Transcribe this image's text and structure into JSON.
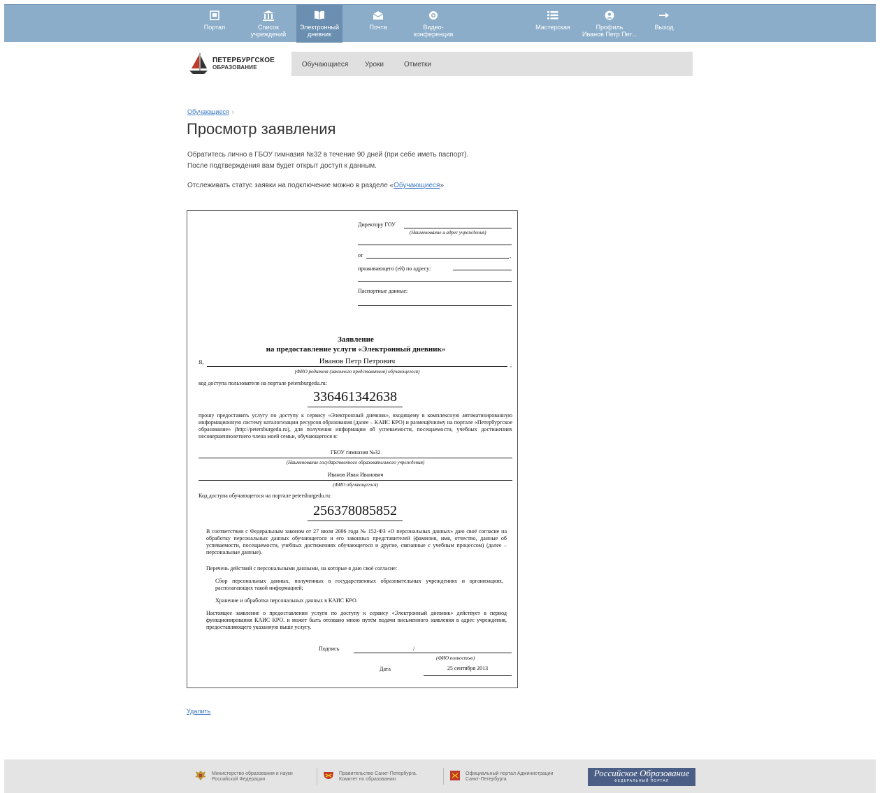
{
  "nav": {
    "items": [
      {
        "label": "Портал",
        "icon": "portal-icon"
      },
      {
        "label": "Список учреждений",
        "icon": "institution-icon"
      },
      {
        "label": "Электронный\nдневник",
        "icon": "book-icon",
        "active": true
      },
      {
        "label": "Почта",
        "icon": "mail-icon"
      },
      {
        "label": "Видео-\nконференции",
        "icon": "video-icon"
      },
      {
        "label": "Мастерская",
        "icon": "list-icon"
      },
      {
        "label": "Профиль\nИванов Петр Пет...",
        "icon": "profile-icon"
      },
      {
        "label": "Выход",
        "icon": "exit-icon"
      }
    ]
  },
  "logo": {
    "line1": "ПЕТЕРБУРГСКОЕ",
    "line2": "ОБРАЗОВАНИЕ"
  },
  "tabs": [
    "Обучающиеся",
    "Уроки",
    "Отметки"
  ],
  "breadcrumb": {
    "link": "Обучающиеся",
    "sep": "›"
  },
  "page_title": "Просмотр заявления",
  "info": {
    "line1": "Обратитесь лично в ГБОУ гимназия №32 в течение 90 дней (при себе иметь паспорт).",
    "line2": "После подтверждения вам будет открыт доступ к данным.",
    "status_prefix": "Отслеживать статус заявки на подключение можно в разделе «",
    "status_link": "Обучающиеся",
    "status_suffix": "»"
  },
  "doc": {
    "director": "Директору ГОУ",
    "inst_hint": "(Наименование и адрес учреждения)",
    "from": "от",
    "comma": ",",
    "address": "проживающего (ей) по адресу:",
    "passport": "Паспортные данные:",
    "title1": "Заявление",
    "title2": "на предоставление услуги «Электронный дневник»",
    "ya": "Я,",
    "parent_name": "Иванов Петр Петрович",
    "parent_hint": "(ФИО родителя (законного представителя) обучающегося)",
    "code_label": "код доступа пользователя на портале petersburgedu.ru:",
    "code1": "336461342638",
    "para1": "прошу предоставить услугу по доступу к сервису «Электронный дневник», входящему в комплексную автоматизированную информационную систему каталогизации ресурсов образования (далее – КАИС КРО) и размещённому на портале «Петербургское образование» (http://petersburgedu.ru), для получения информации об успеваемости, посещаемости, учебных достижениях несовершеннолетнего члена моей семьи, обучающегося в:",
    "school": "ГБОУ гимназия №32",
    "school_hint": "(Наименование государственного образовательного учреждения)",
    "student": "Иванов Иван Иванович",
    "student_hint": "(ФИО обучающегося)",
    "code2_label": "Код доступа обучающегося на портале petersburgedu.ru:",
    "code2": "256378085852",
    "para2": "В соответствии с Федеральным законом от 27 июля 2006 года № 152-ФЗ «О персональных данных» даю своё согласие на обработку персональных данных обучающегося и его законных представителей (фамилия, имя, отчество, данные об успеваемости, посещаемости, учебных достижениях обучающегося и другие, связанные с учебным процессом) (далее – персональные данные).",
    "para3": "Перечень действий с персональными данными, на которые я даю своё согласие:",
    "item1": "Сбор персональных данных, полученных в государственных образовательных учреждениях и организациях, располагающих такой информацией;",
    "item2": "Хранение и обработка персональных данных в КАИС КРО.",
    "para4": "Настоящее заявление о предоставлении услуги по доступу к сервису «Электронный дневник» действует в период функционирования КАИС КРО. и может быть отозвано мною путём подачи письменного заявления в адрес учреждения, предоставляющего указанную выше услугу.",
    "sign": "Подпись",
    "slash": "/",
    "fio_hint": "(ФИО полностью)",
    "date_label": "Дата",
    "date": "25 сентября 2013"
  },
  "delete_link": "Удалить",
  "footer": {
    "f1": "Министерство образования и науки\nРоссийской Федерации",
    "f2": "Правительство Санкт-Петербурга.\nКомитет по образованию",
    "f3": "Официальный портал Администрации\nСанкт-Петербурга",
    "banner": "Российское Образование",
    "banner_sub": "ФЕДЕРАЛЬНЫЙ ПОРТАЛ"
  }
}
